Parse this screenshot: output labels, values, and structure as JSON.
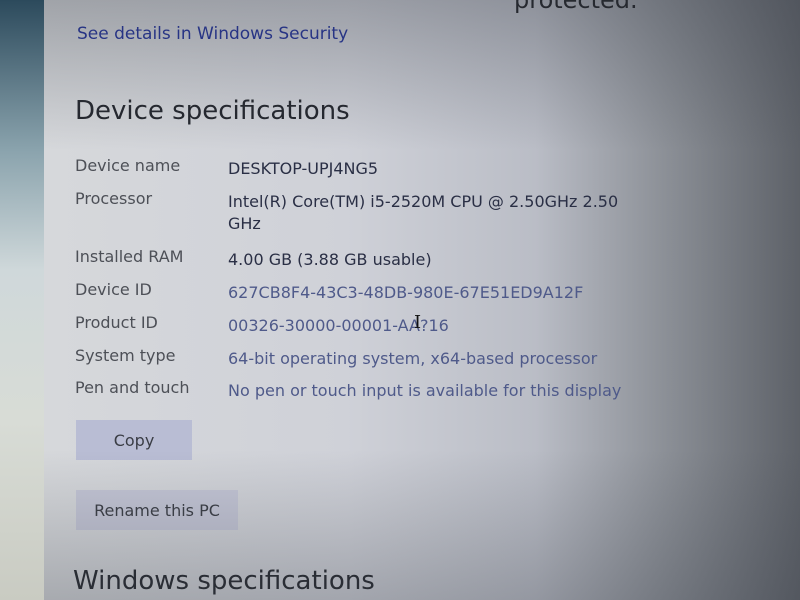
{
  "top_partial_text": "protected.",
  "security_link": "See details in Windows Security",
  "device_specifications": {
    "title": "Device specifications",
    "rows": [
      {
        "label": "Device name",
        "value": "DESKTOP-UPJ4NG5"
      },
      {
        "label": "Processor",
        "value": "Intel(R) Core(TM) i5-2520M CPU @ 2.50GHz   2.50 GHz"
      },
      {
        "label": "Installed RAM",
        "value": "4.00 GB (3.88 GB usable)"
      },
      {
        "label": "Device ID",
        "value": "627CB8F4-43C3-48DB-980E-67E51ED9A12F"
      },
      {
        "label": "Product ID",
        "value": "00326-30000-00001-AA?16"
      },
      {
        "label": "System type",
        "value": "64-bit operating system, x64-based processor"
      },
      {
        "label": "Pen and touch",
        "value": "No pen or touch input is available for this display"
      }
    ],
    "copy_button": "Copy",
    "rename_button": "Rename this PC"
  },
  "windows_specifications": {
    "title": "Windows specifications"
  },
  "cursor_icon": "text-ibeam-cursor"
}
